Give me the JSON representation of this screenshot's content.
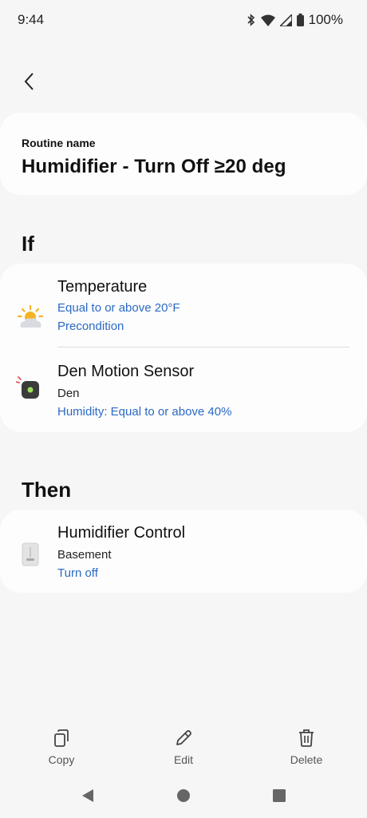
{
  "status_bar": {
    "time": "9:44",
    "battery": "100%",
    "icons": [
      "bluetooth-icon",
      "wifi-icon",
      "signal-icon",
      "battery-icon"
    ]
  },
  "header": {
    "back_icon": "chevron-left-icon"
  },
  "routine": {
    "label": "Routine name",
    "name": "Humidifier - Turn Off ≥20 deg"
  },
  "if_section": {
    "title": "If",
    "items": [
      {
        "icon": "weather-sun-cloud-icon",
        "title": "Temperature",
        "line1": "Equal to or above 20°F",
        "line2": "Precondition"
      },
      {
        "icon": "motion-sensor-icon",
        "title": "Den Motion Sensor",
        "location": "Den",
        "line1": "Humidity: Equal to or above 40%"
      }
    ]
  },
  "then_section": {
    "title": "Then",
    "items": [
      {
        "icon": "humidifier-icon",
        "title": "Humidifier Control",
        "location": "Basement",
        "line1": "Turn off"
      }
    ]
  },
  "actions": {
    "copy": "Copy",
    "edit": "Edit",
    "delete": "Delete"
  },
  "colors": {
    "background": "#f6f6f6",
    "card": "#fdfdfd",
    "accent_blue": "#2b6ac5",
    "sun": "#f5b324"
  }
}
